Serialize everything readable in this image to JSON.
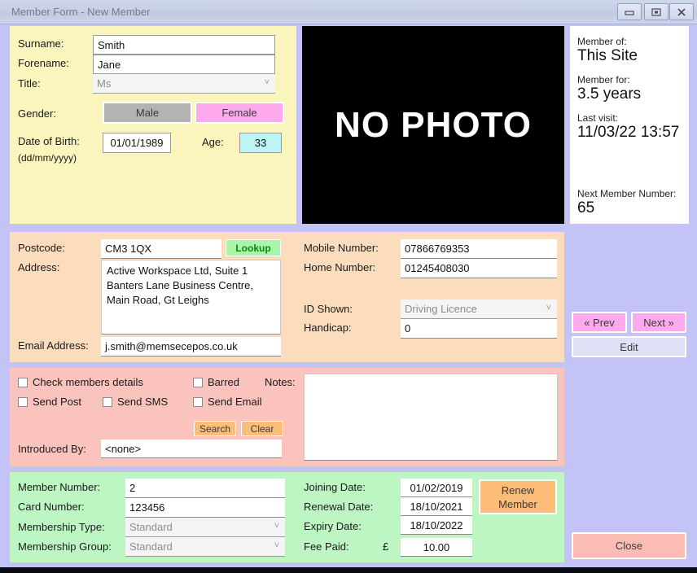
{
  "window": {
    "title": "Member Form - New Member",
    "controls": {
      "minimize": "minimize-icon",
      "restore": "restore-icon",
      "close": "close-icon"
    }
  },
  "personal": {
    "surname_label": "Surname:",
    "surname_value": "Smith",
    "forename_label": "Forename:",
    "forename_value": "Jane",
    "title_label": "Title:",
    "title_value": "Ms",
    "gender_label": "Gender:",
    "male_label": "Male",
    "female_label": "Female",
    "dob_label": "Date of Birth:",
    "dob_format": "(dd/mm/yyyy)",
    "dob_value": "01/01/1989",
    "age_label": "Age:",
    "age_value": "33"
  },
  "photo": {
    "placeholder": "NO PHOTO"
  },
  "info": {
    "member_of_label": "Member of:",
    "member_of_value": "This Site",
    "member_for_label": "Member for:",
    "member_for_value": "3.5 years",
    "last_visit_label": "Last visit:",
    "last_visit_value": "11/03/22 13:57",
    "next_number_label": "Next Member Number:",
    "next_number_value": "65"
  },
  "address": {
    "postcode_label": "Postcode:",
    "postcode_value": "CM3 1QX",
    "lookup_label": "Lookup",
    "address_label": "Address:",
    "address_value": "Active Workspace Ltd, Suite 1 Banters Lane Business Centre, Main Road, Gt Leighs",
    "email_label": "Email Address:",
    "email_value": "j.smith@memsecepos.co.uk",
    "mobile_label": "Mobile Number:",
    "mobile_value": "07866769353",
    "home_label": "Home Number:",
    "home_value": "01245408030",
    "id_shown_label": "ID Shown:",
    "id_shown_value": "Driving Licence",
    "handicap_label": "Handicap:",
    "handicap_value": "0"
  },
  "flags": {
    "check_details_label": "Check members details",
    "barred_label": "Barred",
    "send_post_label": "Send Post",
    "send_sms_label": "Send SMS",
    "send_email_label": "Send Email",
    "search_label": "Search",
    "clear_label": "Clear",
    "introduced_label": "Introduced By:",
    "introduced_value": "<none>",
    "notes_label": "Notes:",
    "notes_value": ""
  },
  "membership": {
    "member_number_label": "Member Number:",
    "member_number_value": "2",
    "card_number_label": "Card Number:",
    "card_number_value": "123456",
    "type_label": "Membership Type:",
    "type_value": "Standard",
    "group_label": "Membership Group:",
    "group_value": "Standard",
    "joining_label": "Joining Date:",
    "joining_value": "01/02/2019",
    "renewal_label": "Renewal Date:",
    "renewal_value": "18/10/2021",
    "expiry_label": "Expiry Date:",
    "expiry_value": "18/10/2022",
    "fee_label": "Fee Paid:",
    "fee_currency": "£",
    "fee_value": "10.00",
    "renew_line1": "Renew",
    "renew_line2": "Member"
  },
  "nav": {
    "prev_label": "« Prev",
    "next_label": "Next »",
    "edit_label": "Edit",
    "close_label": "Close"
  },
  "colors": {
    "window_bg": "#c3c3f7",
    "personal_panel": "#faf5bd",
    "address_panel": "#fbddbd",
    "flags_panel": "#fbc3bd",
    "member_panel": "#bdf5c3",
    "female_selected": "#ffaaee",
    "male_inactive": "#b3b3b3",
    "age_field": "#bdf5f7",
    "lookup": "#aaf5aa",
    "action_orange": "#fbbd77",
    "close_button": "#fbbdb3"
  }
}
